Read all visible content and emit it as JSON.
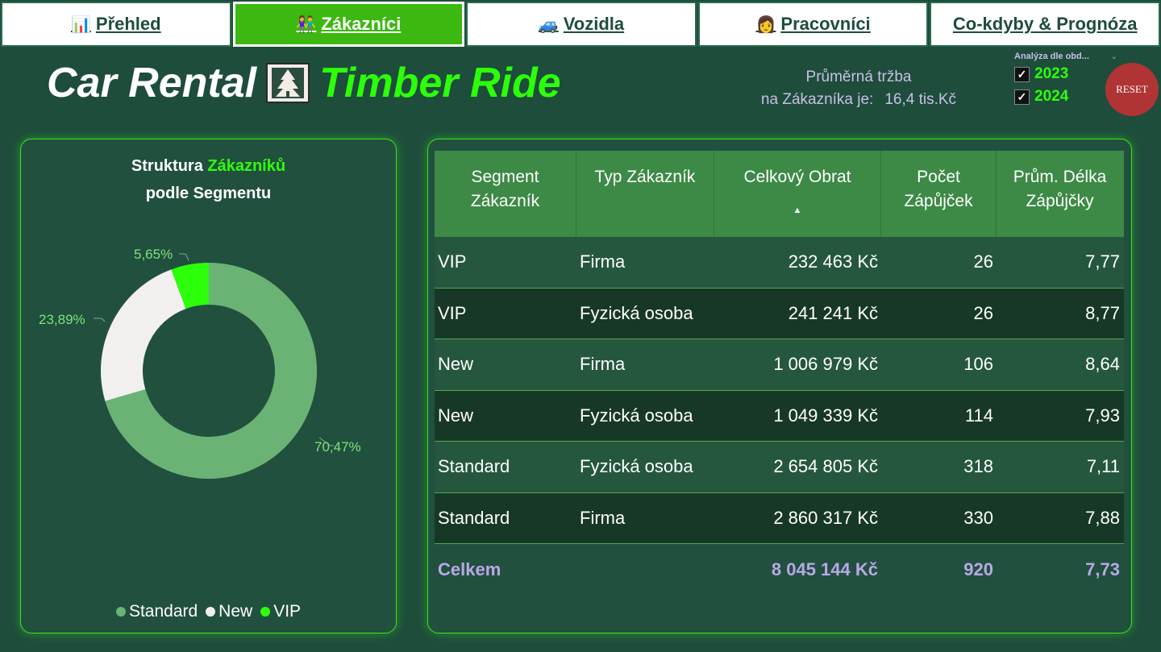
{
  "nav": {
    "tabs": [
      {
        "label": "Přehled",
        "icon": "bar-chart-icon",
        "glyph": "📊",
        "active": false
      },
      {
        "label": "Zákazníci",
        "icon": "people-icon",
        "glyph": "👫",
        "active": true
      },
      {
        "label": "Vozidla",
        "icon": "car-icon",
        "glyph": "🚙",
        "active": false
      },
      {
        "label": "Pracovníci",
        "icon": "worker-icon",
        "glyph": "👩",
        "active": false
      },
      {
        "label": "Co-kdyby & Prognóza",
        "icon": "",
        "glyph": "",
        "active": false
      }
    ]
  },
  "header": {
    "title_part1": "Car Rental",
    "title_part2": "Timber Ride",
    "logo_icon": "tree-icon"
  },
  "kpi": {
    "line1": "Průměrná tržba",
    "line2": "na Zákazníka je:",
    "value": "16,4 tis.Kč"
  },
  "slicer": {
    "title": "Analýza dle obd...",
    "options": [
      {
        "label": "2023",
        "checked": true
      },
      {
        "label": "2024",
        "checked": true
      }
    ]
  },
  "reset_label": "RESET",
  "chart": {
    "title_part1": "Struktura",
    "title_part2": "Zákazníků",
    "title_line2": "podle Segmentu",
    "labels": {
      "standard": "70,47%",
      "new": "23,89%",
      "vip": "5,65%"
    }
  },
  "chart_data": {
    "type": "pie",
    "title": "Struktura Zákazníků podle Segmentu",
    "categories": [
      "Standard",
      "New",
      "VIP"
    ],
    "values": [
      70.47,
      23.89,
      5.65
    ],
    "colors": [
      "#6ab374",
      "#f2f0ef",
      "#2cff0a"
    ],
    "legend": "bottom",
    "donut": true
  },
  "table": {
    "headers": [
      {
        "l1": "Segment",
        "l2": "Zákazník"
      },
      {
        "l1": "Typ Zákazník",
        "l2": ""
      },
      {
        "l1": "Celkový Obrat",
        "l2": ""
      },
      {
        "l1": "Počet",
        "l2": "Zápůjček"
      },
      {
        "l1": "Prům. Délka",
        "l2": "Zápůjčky"
      }
    ],
    "sort_glyph": "▲",
    "rows": [
      [
        "VIP",
        "Firma",
        "232 463 Kč",
        "26",
        "7,77"
      ],
      [
        "VIP",
        "Fyzická osoba",
        "241 241 Kč",
        "26",
        "8,77"
      ],
      [
        "New",
        "Firma",
        "1 006 979 Kč",
        "106",
        "8,64"
      ],
      [
        "New",
        "Fyzická osoba",
        "1 049 339 Kč",
        "114",
        "7,93"
      ],
      [
        "Standard",
        "Fyzická osoba",
        "2 654 805 Kč",
        "318",
        "7,11"
      ],
      [
        "Standard",
        "Firma",
        "2 860 317 Kč",
        "330",
        "7,88"
      ]
    ],
    "total": [
      "Celkem",
      "",
      "8 045 144 Kč",
      "920",
      "7,73"
    ]
  }
}
